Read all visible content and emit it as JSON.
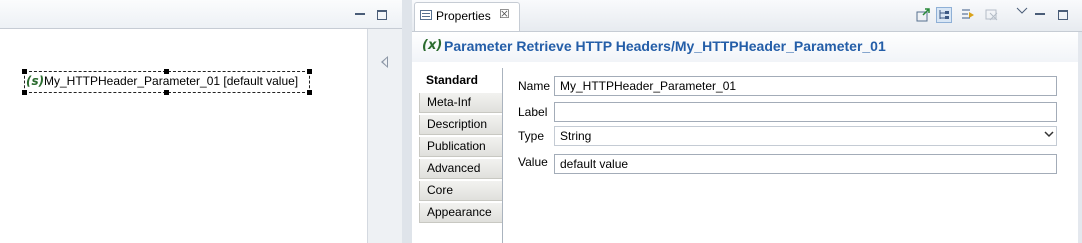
{
  "editor": {
    "node_icon": "(s)",
    "node_label": "My_HTTPHeader_Parameter_01 [default value]"
  },
  "properties_view": {
    "tab_label": "Properties",
    "tab_close": "☒",
    "title_icon": "(x)",
    "title": "Parameter Retrieve HTTP Headers/My_HTTPHeader_Parameter_01",
    "toolbar_icons": [
      "pin-icon",
      "tree-icon",
      "filter-icon",
      "disabled-icon",
      "view-menu-icon",
      "minimize-icon",
      "maximize-icon"
    ],
    "tabs": [
      {
        "label": "Standard"
      },
      {
        "label": "Meta-Inf"
      },
      {
        "label": "Description"
      },
      {
        "label": "Publication"
      },
      {
        "label": "Advanced"
      },
      {
        "label": "Core"
      },
      {
        "label": "Appearance"
      }
    ],
    "active_tab": "Standard",
    "form": {
      "name_label": "Name",
      "name_value": "My_HTTPHeader_Parameter_01",
      "label_label": "Label",
      "label_value": "",
      "type_label": "Type",
      "type_value": "String",
      "value_label": "Value",
      "value_value": "default value"
    }
  },
  "colors": {
    "title": "#245ea8",
    "param_icon": "#2a6b2e"
  }
}
